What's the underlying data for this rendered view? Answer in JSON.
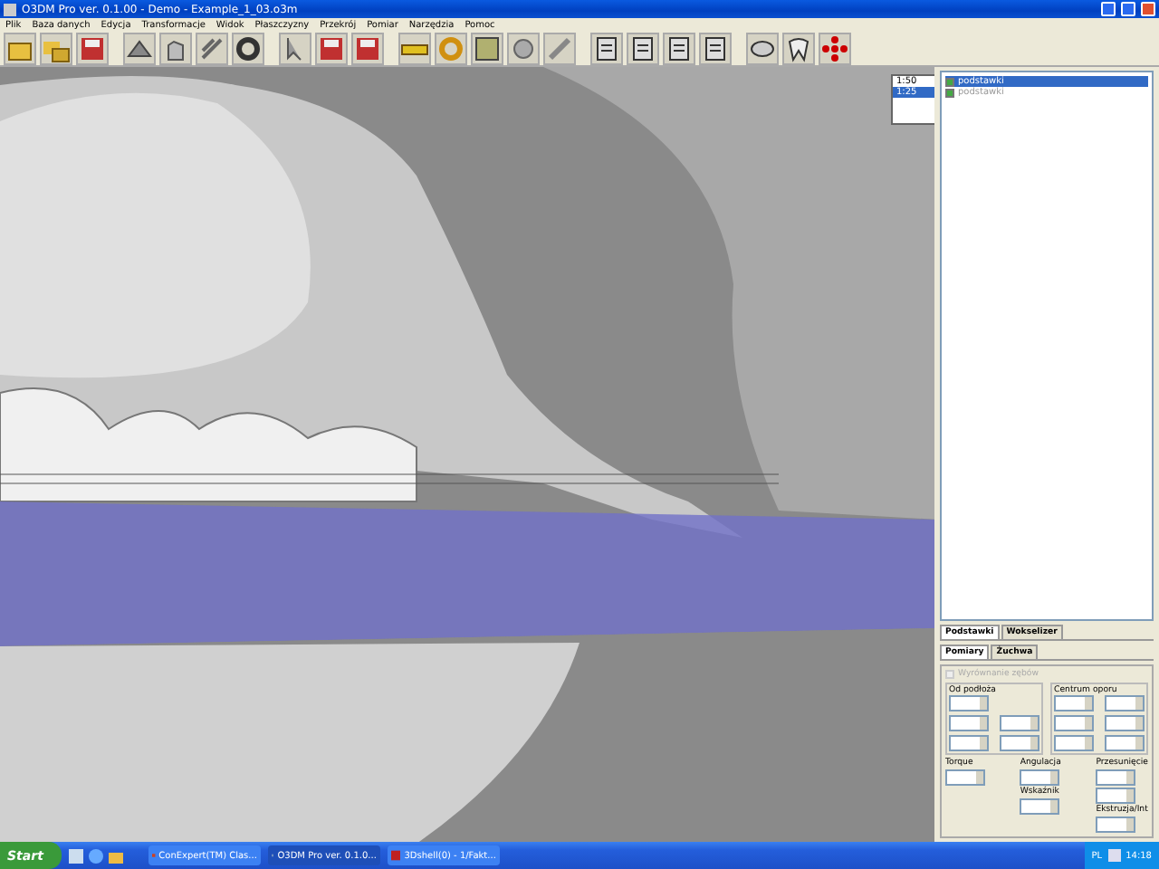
{
  "window": {
    "title": "O3DM Pro ver. 0.1.00 - Demo - Example_1_03.o3m"
  },
  "menu": [
    "Plik",
    "Baza danych",
    "Edycja",
    "Transformacje",
    "Widok",
    "Płaszczyzny",
    "Przekrój",
    "Pomiar",
    "Narzędzia",
    "Pomoc"
  ],
  "scale_list": [
    {
      "label": "1:50",
      "selected": false
    },
    {
      "label": "1:25",
      "selected": true
    }
  ],
  "model_list": [
    {
      "label": "podstawki",
      "selected": true,
      "checked": true
    },
    {
      "label": "podstawki",
      "selected": false,
      "checked": true
    }
  ],
  "tabs": [
    {
      "label": "Podstawki",
      "selected": true
    },
    {
      "label": "Wokselizer",
      "selected": false
    }
  ],
  "subtabs": [
    {
      "label": "Pomiary",
      "selected": true
    },
    {
      "label": "Żuchwa",
      "selected": false
    }
  ],
  "align_checkbox": {
    "label": "Wyrównanie zębów",
    "checked": false,
    "disabled": true
  },
  "groups": [
    {
      "title": "Od podłoża"
    },
    {
      "title": "Centrum oporu"
    }
  ],
  "field_labels": [
    "Torque",
    "Angulacja",
    "Wskaźnik",
    "Przesunięcie",
    "Ekstruzja/Int"
  ],
  "taskbar": {
    "start": "Start",
    "tasks": [
      {
        "label": "ConExpert(TM) Clas...",
        "selected": false
      },
      {
        "label": "O3DM Pro ver. 0.1.0...",
        "selected": true
      },
      {
        "label": "3Dshell(0) - 1/Fakt...",
        "selected": false
      }
    ],
    "language": "PL",
    "clock": "14:18"
  }
}
